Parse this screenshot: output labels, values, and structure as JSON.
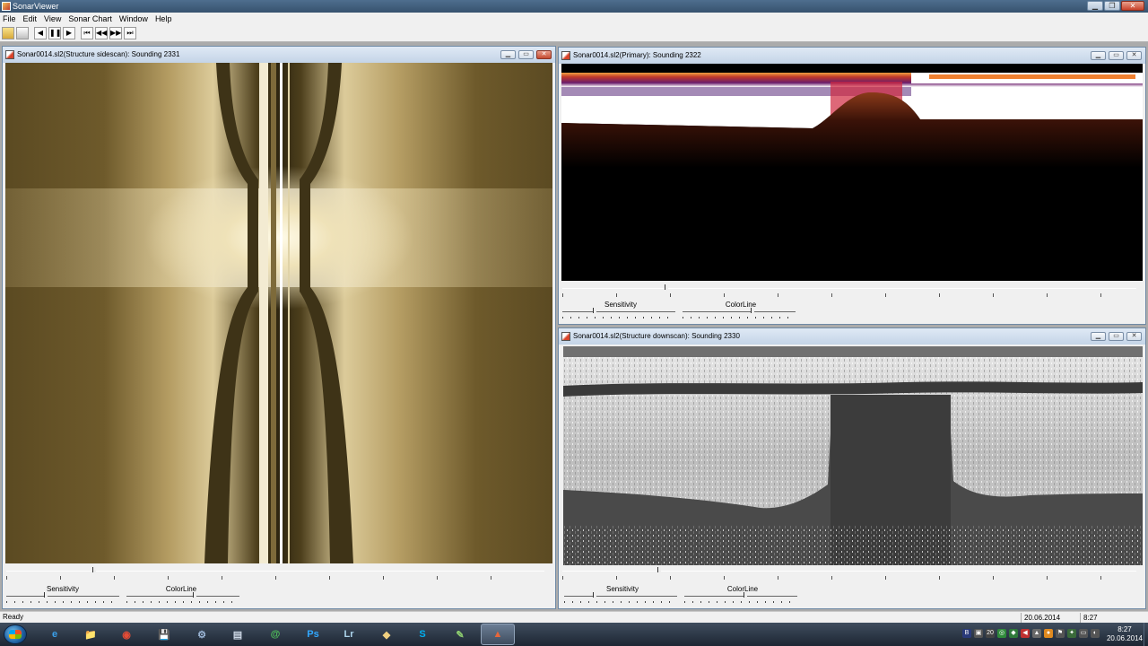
{
  "app": {
    "title": "SonarViewer"
  },
  "menu": [
    "File",
    "Edit",
    "View",
    "Sonar Chart",
    "Window",
    "Help"
  ],
  "toolbar": {
    "buttons": [
      "open-file",
      "print",
      "step-back",
      "pause",
      "play",
      "skip-first",
      "rewind",
      "fast-forward",
      "skip-last"
    ],
    "glyphs": {
      "step-back": "◀",
      "pause": "❚❚",
      "play": "▶",
      "skip-first": "⏮",
      "rewind": "◀◀",
      "fast-forward": "▶▶",
      "skip-last": "⏭"
    }
  },
  "windows": {
    "sidescan": {
      "title": "Sonar0014.sl2(Structure sidescan): Sounding 2331",
      "sensitivity_label": "Sensitivity",
      "colorline_label": "ColorLine",
      "colors": {
        "base": "#5b4a22",
        "bright": "#f5ecd0"
      }
    },
    "primary": {
      "title": "Sonar0014.sl2(Primary): Sounding 2322",
      "sensitivity_label": "Sensitivity",
      "colorline_label": "ColorLine",
      "colors": {
        "water": "#ffffff",
        "bottom": "#000000",
        "surface": "#c0392b"
      }
    },
    "downscan": {
      "title": "Sonar0014.sl2(Structure downscan): Sounding 2330",
      "sensitivity_label": "Sensitivity",
      "colorline_label": "ColorLine",
      "colors": {
        "water": "#c8c8c8",
        "bottom": "#4a4a4a"
      }
    }
  },
  "statusbar": {
    "text": "Ready",
    "date": "20.06.2014",
    "time": "8:27"
  },
  "taskbar": {
    "pins": [
      "e",
      "📁",
      "◉",
      "💾",
      "⚙",
      "▤",
      "@",
      "Ps",
      "Lr",
      "◆",
      "S",
      "✎",
      "▲"
    ],
    "pin_icons": [
      "internet-explorer-icon",
      "folder-icon",
      "chrome-icon",
      "save-icon",
      "tool-icon",
      "document-icon",
      "mail-icon",
      "photoshop-icon",
      "lightroom-icon",
      "note-icon",
      "skype-icon",
      "edit-icon",
      "sonarviewer-icon"
    ],
    "clock_time": "8:27",
    "clock_date": "20.06.2014",
    "tray": [
      "B",
      "▣",
      "20",
      "◎",
      "◆",
      "◀",
      "▲",
      "●",
      "⚑",
      "✦",
      "▭",
      "◐"
    ]
  }
}
